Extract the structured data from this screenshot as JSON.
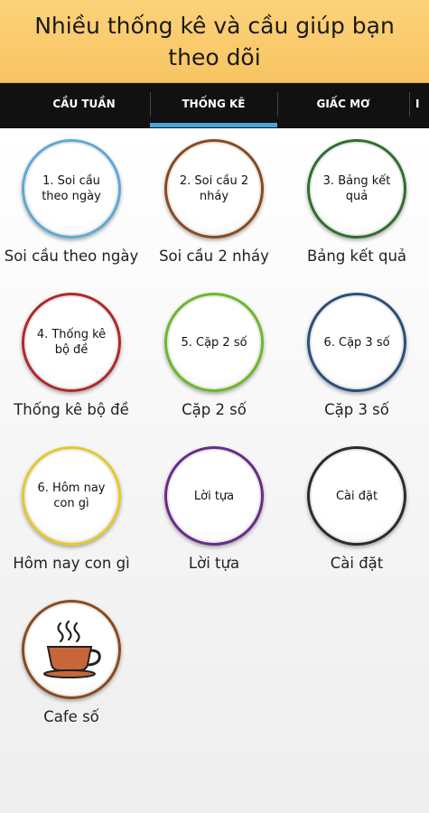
{
  "banner": {
    "title": "Nhiều thống kê và cầu giúp bạn theo dõi"
  },
  "tabs": [
    {
      "label": "CẦU TUẦN"
    },
    {
      "label": "THỐNG KÊ"
    },
    {
      "label": "GIẤC MƠ"
    },
    {
      "label": "I"
    }
  ],
  "items": [
    {
      "circle": "1. Soi cầu theo ngày",
      "caption": "Soi cầu theo ngày",
      "ring": "#5fa8d6"
    },
    {
      "circle": "2. Soi cầu 2 nháy",
      "caption": "Soi cầu 2 nháy",
      "ring": "#8a4a1e"
    },
    {
      "circle": "3. Bảng kết quả",
      "caption": "Bảng kết quả",
      "ring": "#2f6e2f"
    },
    {
      "circle": "4. Thống kê bộ đề",
      "caption": "Thống kê bộ đề",
      "ring": "#b0282e"
    },
    {
      "circle": "5. Cặp 2 số",
      "caption": "Cặp 2 số",
      "ring": "#6ab82a"
    },
    {
      "circle": "6. Cặp 3 số",
      "caption": "Cặp 3 số",
      "ring": "#2a4f7a"
    },
    {
      "circle": "6. Hôm nay con gì",
      "caption": "Hôm nay con gì",
      "ring": "#e6c82a"
    },
    {
      "circle": "Lời tựa",
      "caption": "Lời tựa",
      "ring": "#6a2a8a"
    },
    {
      "circle": "Cài đặt",
      "caption": "Cài đặt",
      "ring": "#2b2b2b"
    },
    {
      "circle": "",
      "caption": "Cafe số",
      "ring": "#8a4a1e",
      "icon": "coffee-cup-icon"
    }
  ],
  "colors": {
    "banner": "#f8c462",
    "tabbar": "#111111",
    "active_indicator": "#4aa3de"
  }
}
